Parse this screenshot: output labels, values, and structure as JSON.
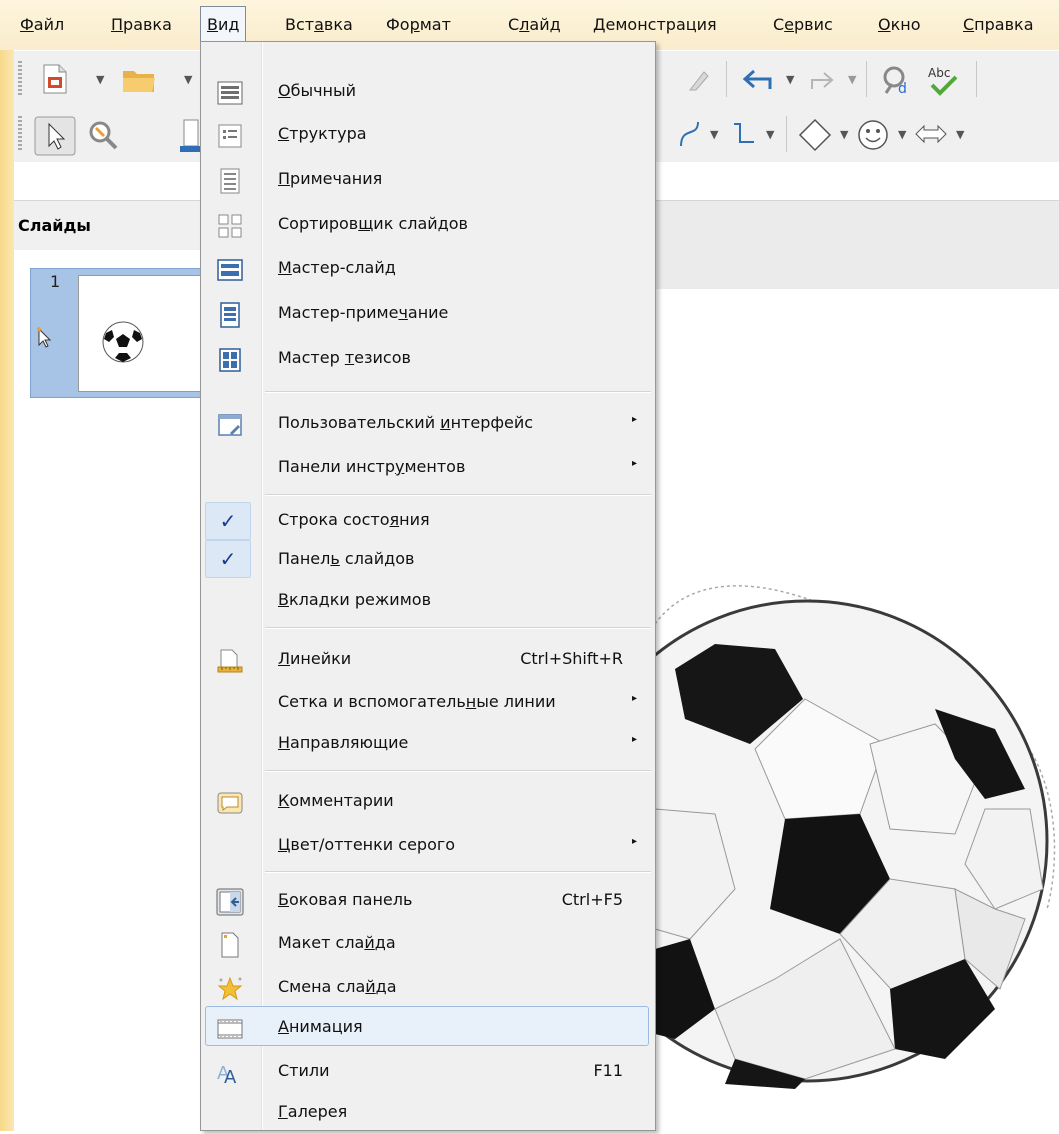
{
  "menubar": {
    "items": [
      {
        "pre": "",
        "u": "Ф",
        "post": "айл"
      },
      {
        "pre": "",
        "u": "П",
        "post": "равка"
      },
      {
        "pre": "",
        "u": "В",
        "post": "ид"
      },
      {
        "pre": "Вст",
        "u": "а",
        "post": "вка"
      },
      {
        "pre": "Фо",
        "u": "р",
        "post": "мат"
      },
      {
        "pre": "С",
        "u": "л",
        "post": "айд"
      },
      {
        "pre": "",
        "u": "Д",
        "post": "емонстрация"
      },
      {
        "pre": "С",
        "u": "е",
        "post": "рвис"
      },
      {
        "pre": "",
        "u": "О",
        "post": "кно"
      },
      {
        "pre": "",
        "u": "С",
        "post": "правка"
      }
    ]
  },
  "slides_pane": {
    "title": "Слайды",
    "slide_number": "1"
  },
  "view_menu": {
    "items": [
      {
        "pre": "",
        "u": "О",
        "post": "бычный",
        "icon": "normal-view-icon"
      },
      {
        "pre": "",
        "u": "С",
        "post": "труктура",
        "icon": "outline-view-icon"
      },
      {
        "pre": "",
        "u": "П",
        "post": "римечания",
        "icon": "notes-view-icon"
      },
      {
        "pre": "Сортиров",
        "u": "щ",
        "post": "ик слайдов",
        "icon": "slide-sorter-icon"
      },
      {
        "pre": "",
        "u": "М",
        "post": "астер-слайд",
        "icon": "master-slide-icon"
      },
      {
        "pre": "Мастер-приме",
        "u": "ч",
        "post": "ание",
        "icon": "master-notes-icon"
      },
      {
        "pre": "Мастер ",
        "u": "т",
        "post": "езисов",
        "icon": "master-handout-icon"
      },
      {
        "pre": "Пользовательский ",
        "u": "и",
        "post": "нтерфейс",
        "icon": "user-interface-icon",
        "submenu": true
      },
      {
        "pre": "Панели инстр",
        "u": "у",
        "post": "ментов",
        "submenu": true
      },
      {
        "pre": "Строка состо",
        "u": "я",
        "post": "ния",
        "checked": true
      },
      {
        "pre": "Панел",
        "u": "ь",
        "post": " слайдов",
        "checked": true
      },
      {
        "pre": "",
        "u": "В",
        "post": "кладки режимов"
      },
      {
        "pre": "",
        "u": "Л",
        "post": "инейки",
        "icon": "rulers-icon",
        "shortcut": "Ctrl+Shift+R"
      },
      {
        "pre": "Сетка и вспомогатель",
        "u": "н",
        "post": "ые линии",
        "submenu": true
      },
      {
        "pre": "",
        "u": "Н",
        "post": "аправляющие",
        "submenu": true
      },
      {
        "pre": "",
        "u": "К",
        "post": "омментарии",
        "icon": "comments-icon"
      },
      {
        "pre": "",
        "u": "Ц",
        "post": "вет/оттенки серого",
        "submenu": true
      },
      {
        "pre": "",
        "u": "Б",
        "post": "оковая панель",
        "icon": "sidebar-icon",
        "shortcut": "Ctrl+F5"
      },
      {
        "pre": "Макет сла",
        "u": "й",
        "post": "да",
        "icon": "slide-layout-icon"
      },
      {
        "pre": "Смена сла",
        "u": "й",
        "post": "да",
        "icon": "slide-transition-icon"
      },
      {
        "pre": "",
        "u": "А",
        "post": "нимация",
        "icon": "animation-icon",
        "highlighted": true
      },
      {
        "pre": "Стили",
        "u": "",
        "post": "",
        "icon": "styles-icon",
        "shortcut": "F11"
      },
      {
        "pre": "",
        "u": "Г",
        "post": "алерея"
      }
    ],
    "check_glyph": "✓",
    "submenu_glyph": "▸"
  }
}
